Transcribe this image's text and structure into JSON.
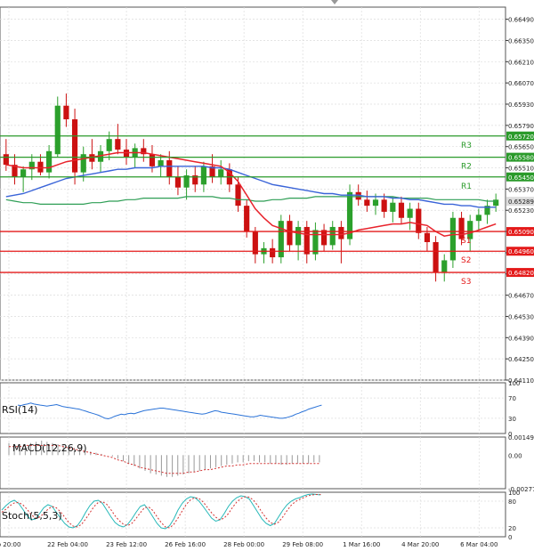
{
  "colors": {
    "background": "#ffffff",
    "grid": "#dcdcdc",
    "bull": "#2ca02c",
    "bear": "#cc1111",
    "ema_fast": "#e8232c",
    "ma_slow": "#3a64d8",
    "ma_mid": "#2e9e55",
    "resistance": "#2a9a2a",
    "support": "#e41a1a",
    "label_bg_resistance": "#2a9a2a",
    "label_bg_support": "#e41a1a",
    "current_price_bg": "#dcdcdc",
    "rsi_line": "#2b73d8",
    "macd_hist": "#999999",
    "macd_signal": "#d43030",
    "stoch_main": "#26b8b8",
    "stoch_signal": "#d43030"
  },
  "chart_data": [
    {
      "type": "candlestick",
      "panel": "price",
      "y_ticks": [
        "0.66490",
        "0.66350",
        "0.66210",
        "0.66070",
        "0.65930",
        "0.65790",
        "0.65650",
        "0.65510",
        "0.65370",
        "0.65230",
        "0.65090",
        "0.64950",
        "0.64810",
        "0.64670",
        "0.64530",
        "0.64390",
        "0.64250",
        "0.64110"
      ],
      "ylim": [
        0.6411,
        0.6657
      ],
      "x_tick_labels": [
        "b 20:00",
        "22 Feb 04:00",
        "23 Feb 12:00",
        "26 Feb 16:00",
        "28 Feb 00:00",
        "29 Feb 08:00",
        "1 Mar 16:00",
        "4 Mar 20:00",
        "6 Mar 04:00"
      ],
      "levels": [
        {
          "name": "R3",
          "value": 0.6572,
          "tag": "0.65720",
          "kind": "resistance"
        },
        {
          "name": "R2",
          "value": 0.6558,
          "tag": "0.65580",
          "kind": "resistance"
        },
        {
          "name": "R1",
          "value": 0.6545,
          "tag": "0.65450",
          "kind": "resistance"
        },
        {
          "name": "S1",
          "value": 0.6509,
          "tag": "0.65090",
          "kind": "support"
        },
        {
          "name": "S2",
          "value": 0.6496,
          "tag": "0.64960",
          "kind": "support"
        },
        {
          "name": "S3",
          "value": 0.6482,
          "tag": "0.64820",
          "kind": "support"
        }
      ],
      "current_price": {
        "value": 0.65289,
        "tag": "0.65289"
      },
      "candles": [
        {
          "o": 0.656,
          "h": 0.657,
          "l": 0.6549,
          "c": 0.6553
        },
        {
          "o": 0.6553,
          "h": 0.656,
          "l": 0.654,
          "c": 0.6545
        },
        {
          "o": 0.6545,
          "h": 0.6552,
          "l": 0.6535,
          "c": 0.655
        },
        {
          "o": 0.655,
          "h": 0.656,
          "l": 0.6543,
          "c": 0.6555
        },
        {
          "o": 0.6555,
          "h": 0.656,
          "l": 0.6546,
          "c": 0.6548
        },
        {
          "o": 0.6548,
          "h": 0.6566,
          "l": 0.6544,
          "c": 0.6562
        },
        {
          "o": 0.656,
          "h": 0.6598,
          "l": 0.6558,
          "c": 0.6592
        },
        {
          "o": 0.6592,
          "h": 0.66,
          "l": 0.6578,
          "c": 0.6583
        },
        {
          "o": 0.6583,
          "h": 0.659,
          "l": 0.654,
          "c": 0.6548
        },
        {
          "o": 0.6548,
          "h": 0.6565,
          "l": 0.6542,
          "c": 0.656
        },
        {
          "o": 0.656,
          "h": 0.657,
          "l": 0.655,
          "c": 0.6555
        },
        {
          "o": 0.6555,
          "h": 0.6566,
          "l": 0.6548,
          "c": 0.6562
        },
        {
          "o": 0.6562,
          "h": 0.6575,
          "l": 0.6556,
          "c": 0.657
        },
        {
          "o": 0.657,
          "h": 0.658,
          "l": 0.656,
          "c": 0.6563
        },
        {
          "o": 0.6563,
          "h": 0.657,
          "l": 0.6553,
          "c": 0.6558
        },
        {
          "o": 0.6558,
          "h": 0.6567,
          "l": 0.6551,
          "c": 0.6564
        },
        {
          "o": 0.6564,
          "h": 0.657,
          "l": 0.6555,
          "c": 0.656
        },
        {
          "o": 0.656,
          "h": 0.6566,
          "l": 0.6548,
          "c": 0.6552
        },
        {
          "o": 0.6552,
          "h": 0.656,
          "l": 0.6545,
          "c": 0.6556
        },
        {
          "o": 0.6556,
          "h": 0.6562,
          "l": 0.654,
          "c": 0.6545
        },
        {
          "o": 0.6545,
          "h": 0.6552,
          "l": 0.6533,
          "c": 0.6538
        },
        {
          "o": 0.6538,
          "h": 0.655,
          "l": 0.653,
          "c": 0.6546
        },
        {
          "o": 0.6546,
          "h": 0.6552,
          "l": 0.6535,
          "c": 0.654
        },
        {
          "o": 0.654,
          "h": 0.6555,
          "l": 0.6535,
          "c": 0.6552
        },
        {
          "o": 0.6552,
          "h": 0.656,
          "l": 0.6541,
          "c": 0.6545
        },
        {
          "o": 0.6545,
          "h": 0.6556,
          "l": 0.654,
          "c": 0.655
        },
        {
          "o": 0.655,
          "h": 0.6554,
          "l": 0.6535,
          "c": 0.654
        },
        {
          "o": 0.654,
          "h": 0.6545,
          "l": 0.6522,
          "c": 0.6526
        },
        {
          "o": 0.6526,
          "h": 0.653,
          "l": 0.6505,
          "c": 0.6509
        },
        {
          "o": 0.6509,
          "h": 0.6512,
          "l": 0.6488,
          "c": 0.6494
        },
        {
          "o": 0.6494,
          "h": 0.6502,
          "l": 0.6488,
          "c": 0.6498
        },
        {
          "o": 0.6498,
          "h": 0.6504,
          "l": 0.6488,
          "c": 0.6492
        },
        {
          "o": 0.6492,
          "h": 0.652,
          "l": 0.6488,
          "c": 0.6516
        },
        {
          "o": 0.6516,
          "h": 0.652,
          "l": 0.6496,
          "c": 0.65
        },
        {
          "o": 0.65,
          "h": 0.6516,
          "l": 0.649,
          "c": 0.6512
        },
        {
          "o": 0.6512,
          "h": 0.6516,
          "l": 0.6488,
          "c": 0.6494
        },
        {
          "o": 0.6494,
          "h": 0.6515,
          "l": 0.649,
          "c": 0.651
        },
        {
          "o": 0.651,
          "h": 0.6514,
          "l": 0.6496,
          "c": 0.65
        },
        {
          "o": 0.65,
          "h": 0.6516,
          "l": 0.6497,
          "c": 0.6512
        },
        {
          "o": 0.6512,
          "h": 0.6516,
          "l": 0.6488,
          "c": 0.6504
        },
        {
          "o": 0.6504,
          "h": 0.654,
          "l": 0.65,
          "c": 0.6535
        },
        {
          "o": 0.6535,
          "h": 0.654,
          "l": 0.6526,
          "c": 0.653
        },
        {
          "o": 0.653,
          "h": 0.6536,
          "l": 0.6522,
          "c": 0.6526
        },
        {
          "o": 0.6526,
          "h": 0.6534,
          "l": 0.652,
          "c": 0.653
        },
        {
          "o": 0.653,
          "h": 0.6534,
          "l": 0.6518,
          "c": 0.6522
        },
        {
          "o": 0.6522,
          "h": 0.6532,
          "l": 0.6515,
          "c": 0.6528
        },
        {
          "o": 0.6528,
          "h": 0.6532,
          "l": 0.6514,
          "c": 0.6518
        },
        {
          "o": 0.6518,
          "h": 0.6528,
          "l": 0.651,
          "c": 0.6524
        },
        {
          "o": 0.6524,
          "h": 0.6528,
          "l": 0.6504,
          "c": 0.6508
        },
        {
          "o": 0.6508,
          "h": 0.6512,
          "l": 0.6496,
          "c": 0.6502
        },
        {
          "o": 0.6502,
          "h": 0.6506,
          "l": 0.6476,
          "c": 0.6482
        },
        {
          "o": 0.6482,
          "h": 0.6494,
          "l": 0.6476,
          "c": 0.649
        },
        {
          "o": 0.649,
          "h": 0.6522,
          "l": 0.6485,
          "c": 0.6518
        },
        {
          "o": 0.6518,
          "h": 0.6522,
          "l": 0.65,
          "c": 0.6504
        },
        {
          "o": 0.6504,
          "h": 0.652,
          "l": 0.6496,
          "c": 0.6516
        },
        {
          "o": 0.6516,
          "h": 0.6524,
          "l": 0.651,
          "c": 0.652
        },
        {
          "o": 0.652,
          "h": 0.653,
          "l": 0.6514,
          "c": 0.6526
        },
        {
          "o": 0.6526,
          "h": 0.6534,
          "l": 0.6522,
          "c": 0.653
        }
      ],
      "ma_mid": [
        0.653,
        0.6529,
        0.6528,
        0.6528,
        0.6527,
        0.6527,
        0.6527,
        0.6527,
        0.6527,
        0.6527,
        0.6528,
        0.6528,
        0.6529,
        0.6529,
        0.653,
        0.653,
        0.6531,
        0.6531,
        0.6531,
        0.6531,
        0.6531,
        0.6532,
        0.6532,
        0.6532,
        0.6532,
        0.6531,
        0.6531,
        0.653,
        0.653,
        0.6529,
        0.6529,
        0.653,
        0.653,
        0.6531,
        0.6531,
        0.6531,
        0.6532,
        0.6532,
        0.6532,
        0.6532,
        0.6532,
        0.6532,
        0.6532,
        0.6532,
        0.6532,
        0.6532,
        0.6531,
        0.6531,
        0.6531,
        0.6531,
        0.653,
        0.653,
        0.653,
        0.653,
        0.653,
        0.653,
        0.6529,
        0.6529
      ],
      "ma_slow": [
        0.6532,
        0.6533,
        0.6534,
        0.6536,
        0.6538,
        0.654,
        0.6542,
        0.6544,
        0.6545,
        0.6546,
        0.6547,
        0.6548,
        0.6549,
        0.655,
        0.655,
        0.6551,
        0.6551,
        0.6551,
        0.6552,
        0.6552,
        0.6552,
        0.6552,
        0.6552,
        0.6552,
        0.6551,
        0.6551,
        0.655,
        0.6548,
        0.6546,
        0.6544,
        0.6542,
        0.654,
        0.6539,
        0.6538,
        0.6537,
        0.6536,
        0.6535,
        0.6534,
        0.6534,
        0.6533,
        0.6533,
        0.6533,
        0.6532,
        0.6532,
        0.6532,
        0.6531,
        0.6531,
        0.653,
        0.653,
        0.6529,
        0.6528,
        0.6527,
        0.6527,
        0.6526,
        0.6526,
        0.6525,
        0.6525,
        0.6525
      ],
      "ema_fast": [
        0.6553,
        0.6552,
        0.6551,
        0.6551,
        0.6551,
        0.6551,
        0.6553,
        0.6555,
        0.6556,
        0.6557,
        0.6558,
        0.6559,
        0.656,
        0.6561,
        0.6561,
        0.6561,
        0.6561,
        0.656,
        0.6559,
        0.6558,
        0.6557,
        0.6556,
        0.6555,
        0.6554,
        0.6553,
        0.6552,
        0.6548,
        0.6542,
        0.6533,
        0.6524,
        0.6518,
        0.6513,
        0.6511,
        0.6509,
        0.6508,
        0.6507,
        0.6507,
        0.6507,
        0.6507,
        0.6507,
        0.6508,
        0.651,
        0.6511,
        0.6512,
        0.6513,
        0.6514,
        0.6514,
        0.6515,
        0.6514,
        0.6513,
        0.6509,
        0.6506,
        0.6507,
        0.6507,
        0.6508,
        0.651,
        0.6512,
        0.6514
      ]
    },
    {
      "type": "line",
      "panel": "rsi",
      "title": "RSI(14)",
      "ylim": [
        0,
        100
      ],
      "y_ticks": [
        "100",
        "70",
        "30",
        "0"
      ],
      "series": [
        {
          "values": [
            56,
            55,
            57,
            58,
            60,
            58,
            57,
            56,
            55,
            54,
            55,
            56,
            57,
            55,
            53,
            52,
            51,
            50,
            49,
            48,
            46,
            44,
            42,
            40,
            38,
            36,
            33,
            30,
            29,
            31,
            34,
            36,
            38,
            37,
            39,
            40,
            39,
            41,
            43,
            45,
            46,
            47,
            48,
            49,
            50,
            50,
            49,
            48,
            47,
            46,
            45,
            44,
            43,
            42,
            41,
            40,
            39,
            38,
            39,
            41,
            43,
            45,
            44,
            42,
            41,
            40,
            39,
            38,
            37,
            36,
            35,
            34,
            33,
            33,
            34,
            36,
            35,
            34,
            33,
            32,
            31,
            30,
            30,
            31,
            33,
            35,
            38,
            40,
            43,
            45,
            48,
            50,
            52,
            54,
            56
          ]
        }
      ]
    },
    {
      "type": "bar",
      "panel": "macd",
      "title": "MACD(12,26,9)",
      "y_ticks": [
        "0.001493",
        "0.00",
        "-0.002775"
      ],
      "ylim": [
        -0.002775,
        0.001493
      ],
      "series": [
        {
          "values": [
            0.001,
            0.0009,
            0.0008,
            0.0009,
            0.001,
            0.0011,
            0.0012,
            0.0011,
            0.001,
            0.0009,
            0.0008,
            0.0007,
            0.0006,
            0.0005,
            0.0004,
            0.0003,
            0.0002,
            0.0001,
            0.0,
            -0.0001,
            -0.0003,
            -0.0005,
            -0.0007,
            -0.0009,
            -0.0011,
            -0.0013,
            -0.0015,
            -0.0016,
            -0.0017,
            -0.0018,
            -0.0018,
            -0.0017,
            -0.0016,
            -0.0015,
            -0.0014,
            -0.0013,
            -0.0012,
            -0.0011,
            -0.001,
            -0.0009,
            -0.0008,
            -0.0007,
            -0.0006,
            -0.0006,
            -0.0005,
            -0.0005,
            -0.0006,
            -0.0006,
            -0.0007,
            -0.0007,
            -0.0008,
            -0.0008,
            -0.0007,
            -0.0007,
            -0.0007,
            -0.0007,
            -0.0006,
            -0.0006
          ]
        },
        {
          "values": [
            0.0007,
            0.0007,
            0.0007,
            0.0008,
            0.0008,
            0.0008,
            0.0008,
            0.0008,
            0.0008,
            0.0008,
            0.0007,
            0.0006,
            0.0005,
            0.0004,
            0.0003,
            0.0002,
            0.0001,
            0.0,
            -0.0001,
            -0.0002,
            -0.0004,
            -0.0005,
            -0.0007,
            -0.0008,
            -0.001,
            -0.0011,
            -0.0012,
            -0.0013,
            -0.0014,
            -0.0015,
            -0.0015,
            -0.0015,
            -0.0015,
            -0.0014,
            -0.0014,
            -0.0013,
            -0.0012,
            -0.0012,
            -0.0011,
            -0.001,
            -0.0009,
            -0.0009,
            -0.0008,
            -0.0008,
            -0.0007,
            -0.0007,
            -0.0007,
            -0.0007,
            -0.0007,
            -0.0007,
            -0.0007,
            -0.0007,
            -0.0007,
            -0.0007,
            -0.0007,
            -0.0007,
            -0.0007,
            -0.0007
          ]
        }
      ]
    },
    {
      "type": "line",
      "panel": "stoch",
      "title": "Stoch(5,5,3)",
      "ylim": [
        0,
        100
      ],
      "y_ticks": [
        "100",
        "80",
        "20",
        "0"
      ],
      "series": [
        {
          "values": [
            60,
            70,
            78,
            82,
            75,
            62,
            48,
            38,
            40,
            52,
            65,
            72,
            68,
            55,
            42,
            30,
            22,
            20,
            25,
            38,
            55,
            70,
            80,
            82,
            75,
            60,
            45,
            32,
            25,
            22,
            28,
            40,
            55,
            68,
            72,
            60,
            45,
            30,
            20,
            18,
            25,
            40,
            60,
            75,
            85,
            90,
            88,
            80,
            68,
            55,
            42,
            35,
            38,
            52,
            68,
            80,
            88,
            92,
            90,
            85,
            70,
            55,
            40,
            30,
            25,
            30,
            45,
            60,
            72,
            80,
            85,
            88,
            92,
            95,
            96,
            95,
            94
          ]
        },
        {
          "values": [
            55,
            62,
            70,
            76,
            77,
            72,
            62,
            50,
            42,
            44,
            52,
            62,
            68,
            65,
            56,
            44,
            32,
            24,
            22,
            28,
            40,
            54,
            68,
            77,
            79,
            73,
            61,
            47,
            36,
            28,
            25,
            30,
            41,
            54,
            65,
            67,
            59,
            45,
            32,
            22,
            20,
            28,
            42,
            58,
            73,
            83,
            88,
            86,
            78,
            66,
            54,
            44,
            38,
            42,
            52,
            66,
            78,
            86,
            90,
            89,
            82,
            70,
            55,
            42,
            32,
            28,
            33,
            45,
            59,
            71,
            79,
            84,
            88,
            92,
            94,
            95,
            95
          ]
        }
      ]
    }
  ]
}
